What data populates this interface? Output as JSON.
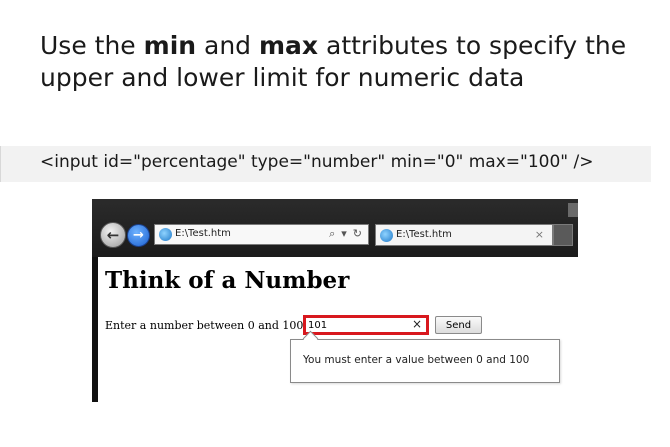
{
  "slide": {
    "heading_part1": "Use the ",
    "heading_min": "min",
    "heading_part2": " and ",
    "heading_max": "max",
    "heading_part3": " attributes to specify the upper and lower limit for numeric data",
    "code_line": "<input id=\"percentage\" type=\"number\" min=\"0\" max=\"100\" />"
  },
  "browser": {
    "address_url": "E:\\Test.htm",
    "tab_title": "E:\\Test.htm",
    "tab_close": "×",
    "search_icon_glyph": "⌕",
    "dropdown_glyph": "▾",
    "refresh_glyph": "↻",
    "back_glyph": "←",
    "forward_glyph": "→",
    "page": {
      "heading": "Think of a Number",
      "prompt_label": "Enter a number between 0 and 100:",
      "input_value": "101",
      "clear_glyph": "×",
      "send_label": "Send",
      "validation_message": "You must enter a value between 0 and 100"
    }
  },
  "colors": {
    "invalid_border": "#d8181e",
    "forward_button": "#1a5fd0"
  }
}
